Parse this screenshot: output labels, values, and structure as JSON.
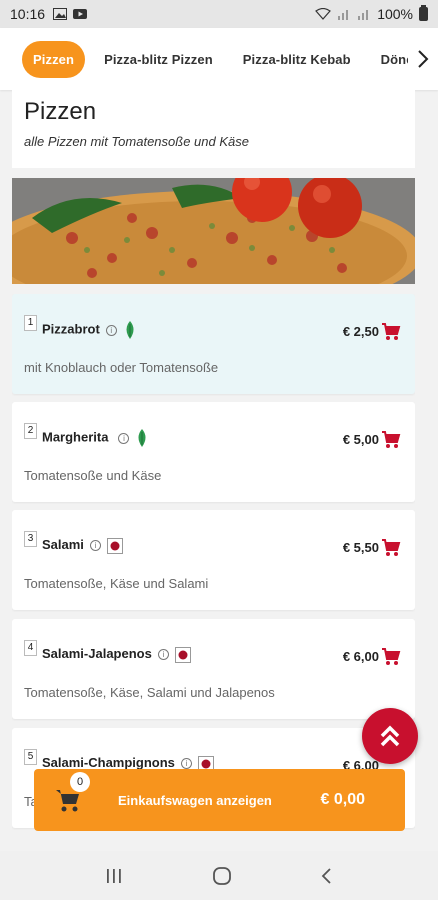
{
  "status": {
    "time": "10:16",
    "battery": "100%"
  },
  "tabs": [
    {
      "label": "Pizzen",
      "active": true
    },
    {
      "label": "Pizza-blitz Pizzen",
      "active": false
    },
    {
      "label": "Pizza-blitz Kebab",
      "active": false
    },
    {
      "label": "Döne",
      "active": false
    }
  ],
  "category": {
    "title": "Pizzen",
    "description": "alle Pizzen mit Tomatensoße und Käse"
  },
  "items": [
    {
      "number": "1",
      "name": "Pizzabrot",
      "badge": "vegetarian-leaf-icon",
      "description": "mit Knoblauch oder Tomatensoße",
      "price": "€ 2,50",
      "highlight": true
    },
    {
      "number": "2",
      "name": "Margherita",
      "badge": "vegetarian-leaf-icon",
      "description": "Tomatensoße und Käse",
      "price": "€ 5,00",
      "highlight": false
    },
    {
      "number": "3",
      "name": "Salami",
      "badge": "meat-dot-icon",
      "description": "Tomatensoße, Käse und Salami",
      "price": "€ 5,50",
      "highlight": false
    },
    {
      "number": "4",
      "name": "Salami-Jalapenos",
      "badge": "meat-dot-icon",
      "description": "Tomatensoße, Käse, Salami und Jalapenos",
      "price": "€ 6,00",
      "highlight": false
    },
    {
      "number": "5",
      "name": "Salami-Champignons",
      "badge": "meat-dot-icon",
      "description": "Ta",
      "price": "€ 6,00",
      "highlight": false
    }
  ],
  "cart": {
    "count": "0",
    "label": "Einkaufswagen anzeigen",
    "total": "€ 0,00"
  },
  "colors": {
    "accent": "#f7941d",
    "brand_red": "#c8102e",
    "leaf": "#2e9b4f"
  }
}
